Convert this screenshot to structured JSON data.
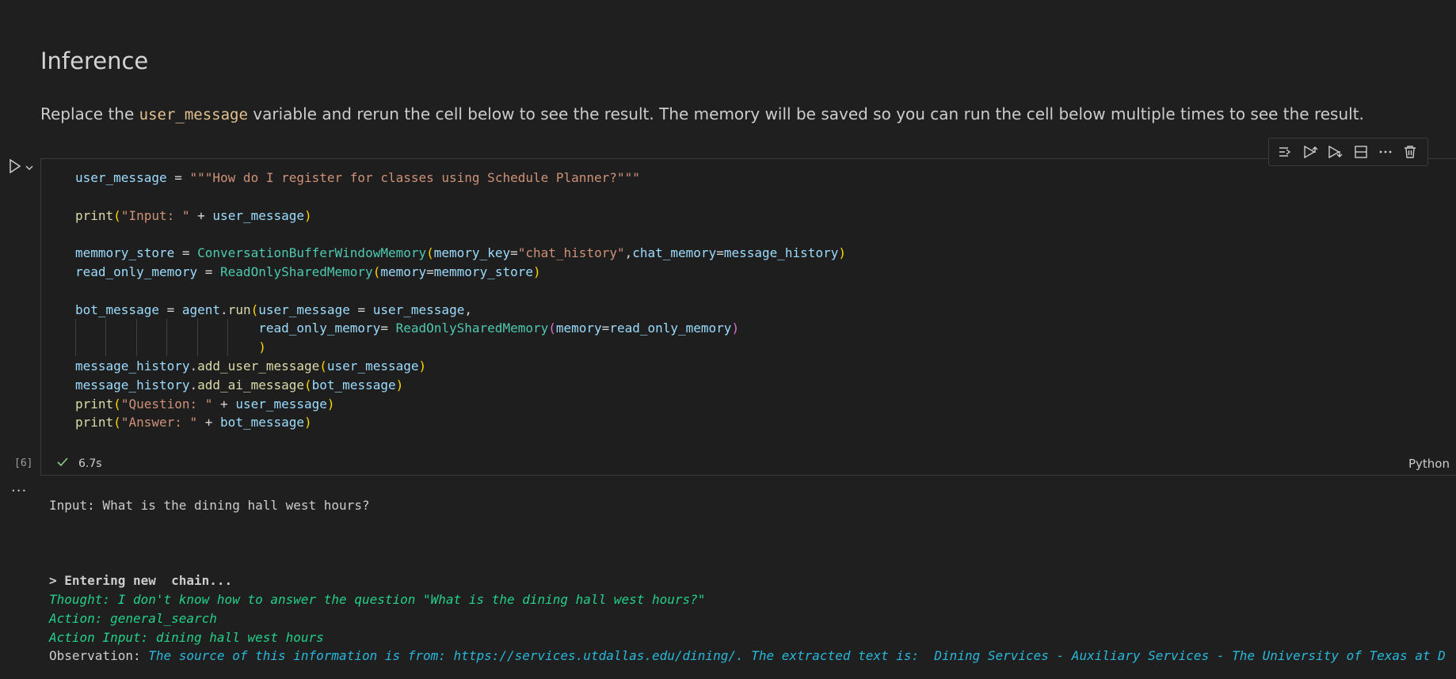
{
  "markdown": {
    "title": "Inference",
    "para_before": "Replace the ",
    "para_code": "user_message",
    "para_after": " variable and rerun the cell below to see the result. The memory will be saved so you can run the cell below multiple times to see the result."
  },
  "toolbar": {
    "items": [
      "execute-above-icon",
      "run-cells-above-icon",
      "run-cells-below-icon",
      "split-cell-icon",
      "more-actions-icon",
      "delete-cell-icon"
    ]
  },
  "code": {
    "l1_var": "user_message",
    "l1_eq": " = ",
    "l1_str": "\"\"\"How do I register for classes using Schedule Planner?\"\"\"",
    "l3_fn": "print",
    "l3_str": "\"Input: \"",
    "l3_op": " + ",
    "l3_var": "user_message",
    "l5_var": "memmory_store",
    "l5_eq": " = ",
    "l5_cls": "ConversationBufferWindowMemory",
    "l5_arg1": "memory_key",
    "l5_str": "\"chat_history\"",
    "l5_arg2": "chat_memory",
    "l5_val2": "message_history",
    "l6_var": "read_only_memory",
    "l6_eq": " = ",
    "l6_cls": "ReadOnlySharedMemory",
    "l6_arg": "memory",
    "l6_val": "memmory_store",
    "l8_var": "bot_message",
    "l8_eq": " = ",
    "l8_obj": "agent",
    "l8_fn": "run",
    "l8_arg": "user_message",
    "l8_val": "user_message",
    "l9_arg": "read_only_memory",
    "l9_cls": "ReadOnlySharedMemory",
    "l9_arg2": "memory",
    "l9_val2": "read_only_memory",
    "l11_obj": "message_history",
    "l11_fn": "add_user_message",
    "l11_val": "user_message",
    "l12_obj": "message_history",
    "l12_fn": "add_ai_message",
    "l12_val": "bot_message",
    "l13_fn": "print",
    "l13_str": "\"Question: \"",
    "l13_op": " + ",
    "l13_var": "user_message",
    "l14_fn": "print",
    "l14_str": "\"Answer: \"",
    "l14_op": " + ",
    "l14_var": "bot_message"
  },
  "cell": {
    "execution_count": "[6]",
    "duration": "6.7s",
    "language": "Python"
  },
  "output": {
    "input_line": "Input: What is the dining hall west hours?",
    "entering": "> Entering new  chain...",
    "thought": "Thought: I don't know how to answer the question \"What is the dining hall west hours?\"",
    "action": "Action: general_search",
    "action_input": "Action Input: dining hall west hours",
    "observation_label": "Observation: ",
    "observation_text": "The source of this information is from: https://services.utdallas.edu/dining/. The extracted text is:  Dining Services - Auxiliary Services - The University of Texas at D"
  },
  "colors": {
    "background": "#1f1f1f",
    "string": "#ce9178",
    "function": "#dcdcaa",
    "class": "#4ec9b0",
    "variable": "#9cdcfe",
    "output_green": "#23d18b",
    "output_cyan": "#29b8db"
  }
}
